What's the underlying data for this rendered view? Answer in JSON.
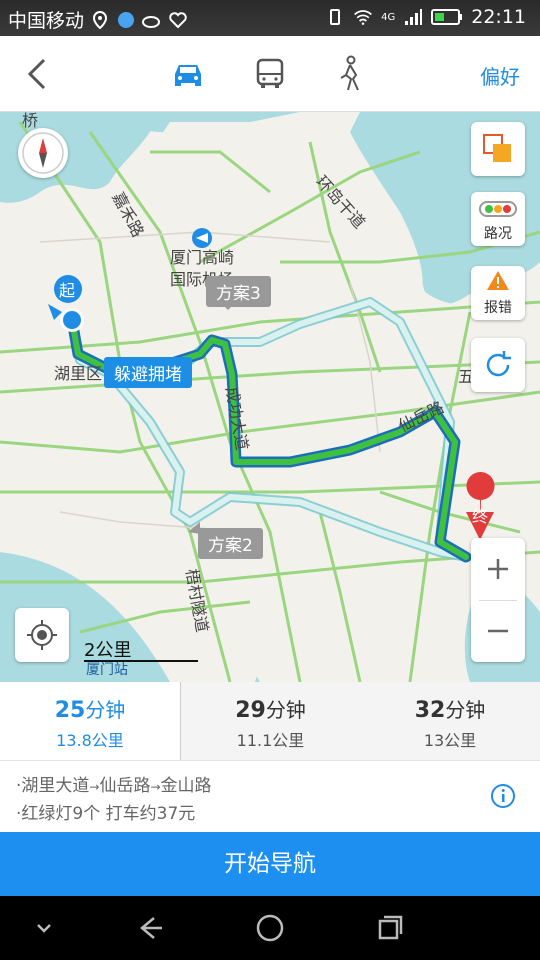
{
  "status_bar": {
    "carrier": "中国移动",
    "network": "4G",
    "time": "22:11"
  },
  "toolbar": {
    "modes": [
      "car-icon",
      "bus-icon",
      "walk-icon"
    ],
    "active_mode": "car",
    "preference_label": "偏好"
  },
  "map": {
    "road_labels": [
      "嘉禾路",
      "环岛干道",
      "成功大道",
      "仙岳路",
      "梧村隧道",
      "湖里区",
      "五",
      "桥"
    ],
    "poi_labels": [
      "厦门高崎",
      "国际机场",
      "厦门站"
    ],
    "start_label": "起",
    "end_label": "终",
    "traffic_label": "路况",
    "report_label": "报错",
    "route_tags": {
      "main": "躲避拥堵",
      "alt3": "方案3",
      "alt2": "方案2"
    },
    "scale": "2公里"
  },
  "routes": [
    {
      "time": "25",
      "unit": "分钟",
      "distance": "13.8公里",
      "selected": true
    },
    {
      "time": "29",
      "unit": "分钟",
      "distance": "11.1公里",
      "selected": false
    },
    {
      "time": "32",
      "unit": "分钟",
      "distance": "13公里",
      "selected": false
    }
  ],
  "detail": {
    "road_1": "·湖里大道",
    "road_2": "仙岳路",
    "road_3": "金山路",
    "arrow": "→",
    "lights": "·红绿灯9个",
    "taxi": "打车约37元"
  },
  "start_nav_label": "开始导航",
  "colors": {
    "accent": "#1d8ff0",
    "route_green": "#3fbf3f",
    "route_pale": "#bfe6e6"
  }
}
